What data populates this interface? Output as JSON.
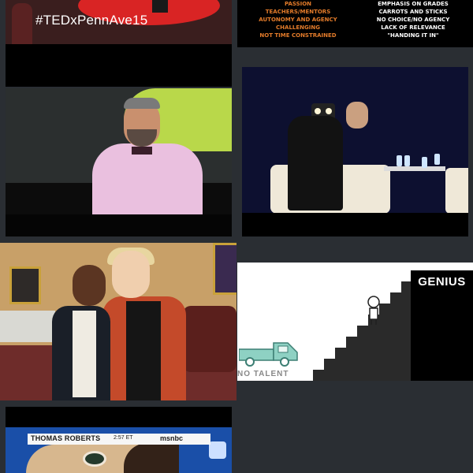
{
  "tiles": {
    "tedx": {
      "hashtag": "#TEDxPennAve15"
    },
    "slide": {
      "left_items": [
        "PASSION",
        "TEACHERS/MENTORS",
        "AUTONOMY AND AGENCY",
        "CHALLENGING",
        "NOT TIME CONSTRAINED"
      ],
      "right_items": [
        "EMPHASIS ON GRADES",
        "CARROTS AND STICKS",
        "NO CHOICE/NO AGENCY",
        "LACK OF RELEVANCE",
        "\"HANDING IT IN\""
      ],
      "left_color": "#e37b2a",
      "right_color": "#ffffff"
    },
    "genius": {
      "label": "GENIUS",
      "caption": "NO TALENT"
    },
    "news": {
      "name": "THOMAS ROBERTS",
      "time": "2:57 ET",
      "network": "msnbc"
    }
  },
  "colors": {
    "background": "#2a2e33",
    "ted_red": "#d92424"
  }
}
